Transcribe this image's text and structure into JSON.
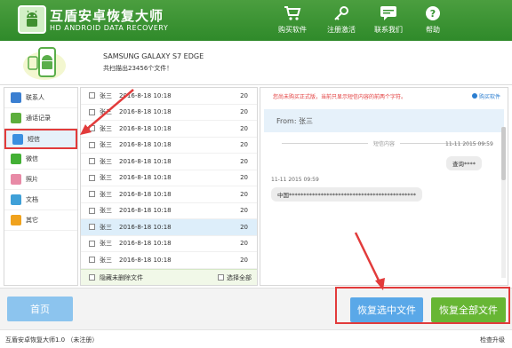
{
  "app": {
    "title": "互盾安卓恢复大师",
    "subtitle": "HD ANDROID DATA RECOVERY"
  },
  "toolbar": {
    "buy": "购买软件",
    "register": "注册激活",
    "contact": "联系我们",
    "help": "帮助"
  },
  "device": {
    "name": "SAMSUNG GALAXY S7 EDGE",
    "count_text": "共扫描出23456个文件！"
  },
  "sidebar": {
    "items": [
      {
        "label": "联系人",
        "color": "#3b7fd1"
      },
      {
        "label": "通话记录",
        "color": "#5cae3c"
      },
      {
        "label": "短信",
        "color": "#3a8fe0"
      },
      {
        "label": "微信",
        "color": "#43b035"
      },
      {
        "label": "照片",
        "color": "#e88aa6"
      },
      {
        "label": "文档",
        "color": "#3fa0d8"
      },
      {
        "label": "其它",
        "color": "#f0a21d"
      }
    ]
  },
  "list": {
    "rows": [
      {
        "name": "张三",
        "date": "2016-8-18 10:18",
        "count": "20"
      },
      {
        "name": "张三",
        "date": "2016-8-18 10:18",
        "count": "20"
      },
      {
        "name": "张三",
        "date": "2016-8-18 10:18",
        "count": "20"
      },
      {
        "name": "张三",
        "date": "2016-8-18 10:18",
        "count": "20"
      },
      {
        "name": "张三",
        "date": "2016-8-18 10:18",
        "count": "20"
      },
      {
        "name": "张三",
        "date": "2016-8-18 10:18",
        "count": "20"
      },
      {
        "name": "张三",
        "date": "2016-8-18 10:18",
        "count": "20"
      },
      {
        "name": "张三",
        "date": "2016-8-18 10:18",
        "count": "20"
      },
      {
        "name": "张三",
        "date": "2016-8-18 10:18",
        "count": "20"
      },
      {
        "name": "张三",
        "date": "2016-8-18 10:18",
        "count": "20"
      },
      {
        "name": "张三",
        "date": "2016-8-18 10:18",
        "count": "20"
      }
    ],
    "hide_deleted": "隐藏未删除文件",
    "select_all": "选择全部"
  },
  "detail": {
    "notice": "您尚未购买正式版，当前只显示短信内容的前两个字符。",
    "buy_link": "购买软件",
    "from": "From: 张三",
    "divider_label": "短信内容",
    "msg1": {
      "time": "11-11 2015 09:59",
      "text": "查询****"
    },
    "msg2": {
      "time": "11-11 2015 09:59",
      "text": "中国********************************************"
    }
  },
  "actions": {
    "home": "首页",
    "recover_selected": "恢复选中文件",
    "recover_all": "恢复全部文件"
  },
  "status": {
    "version": "互盾安卓恢复大师1.0 （未注册）",
    "upgrade": "检查升级"
  }
}
